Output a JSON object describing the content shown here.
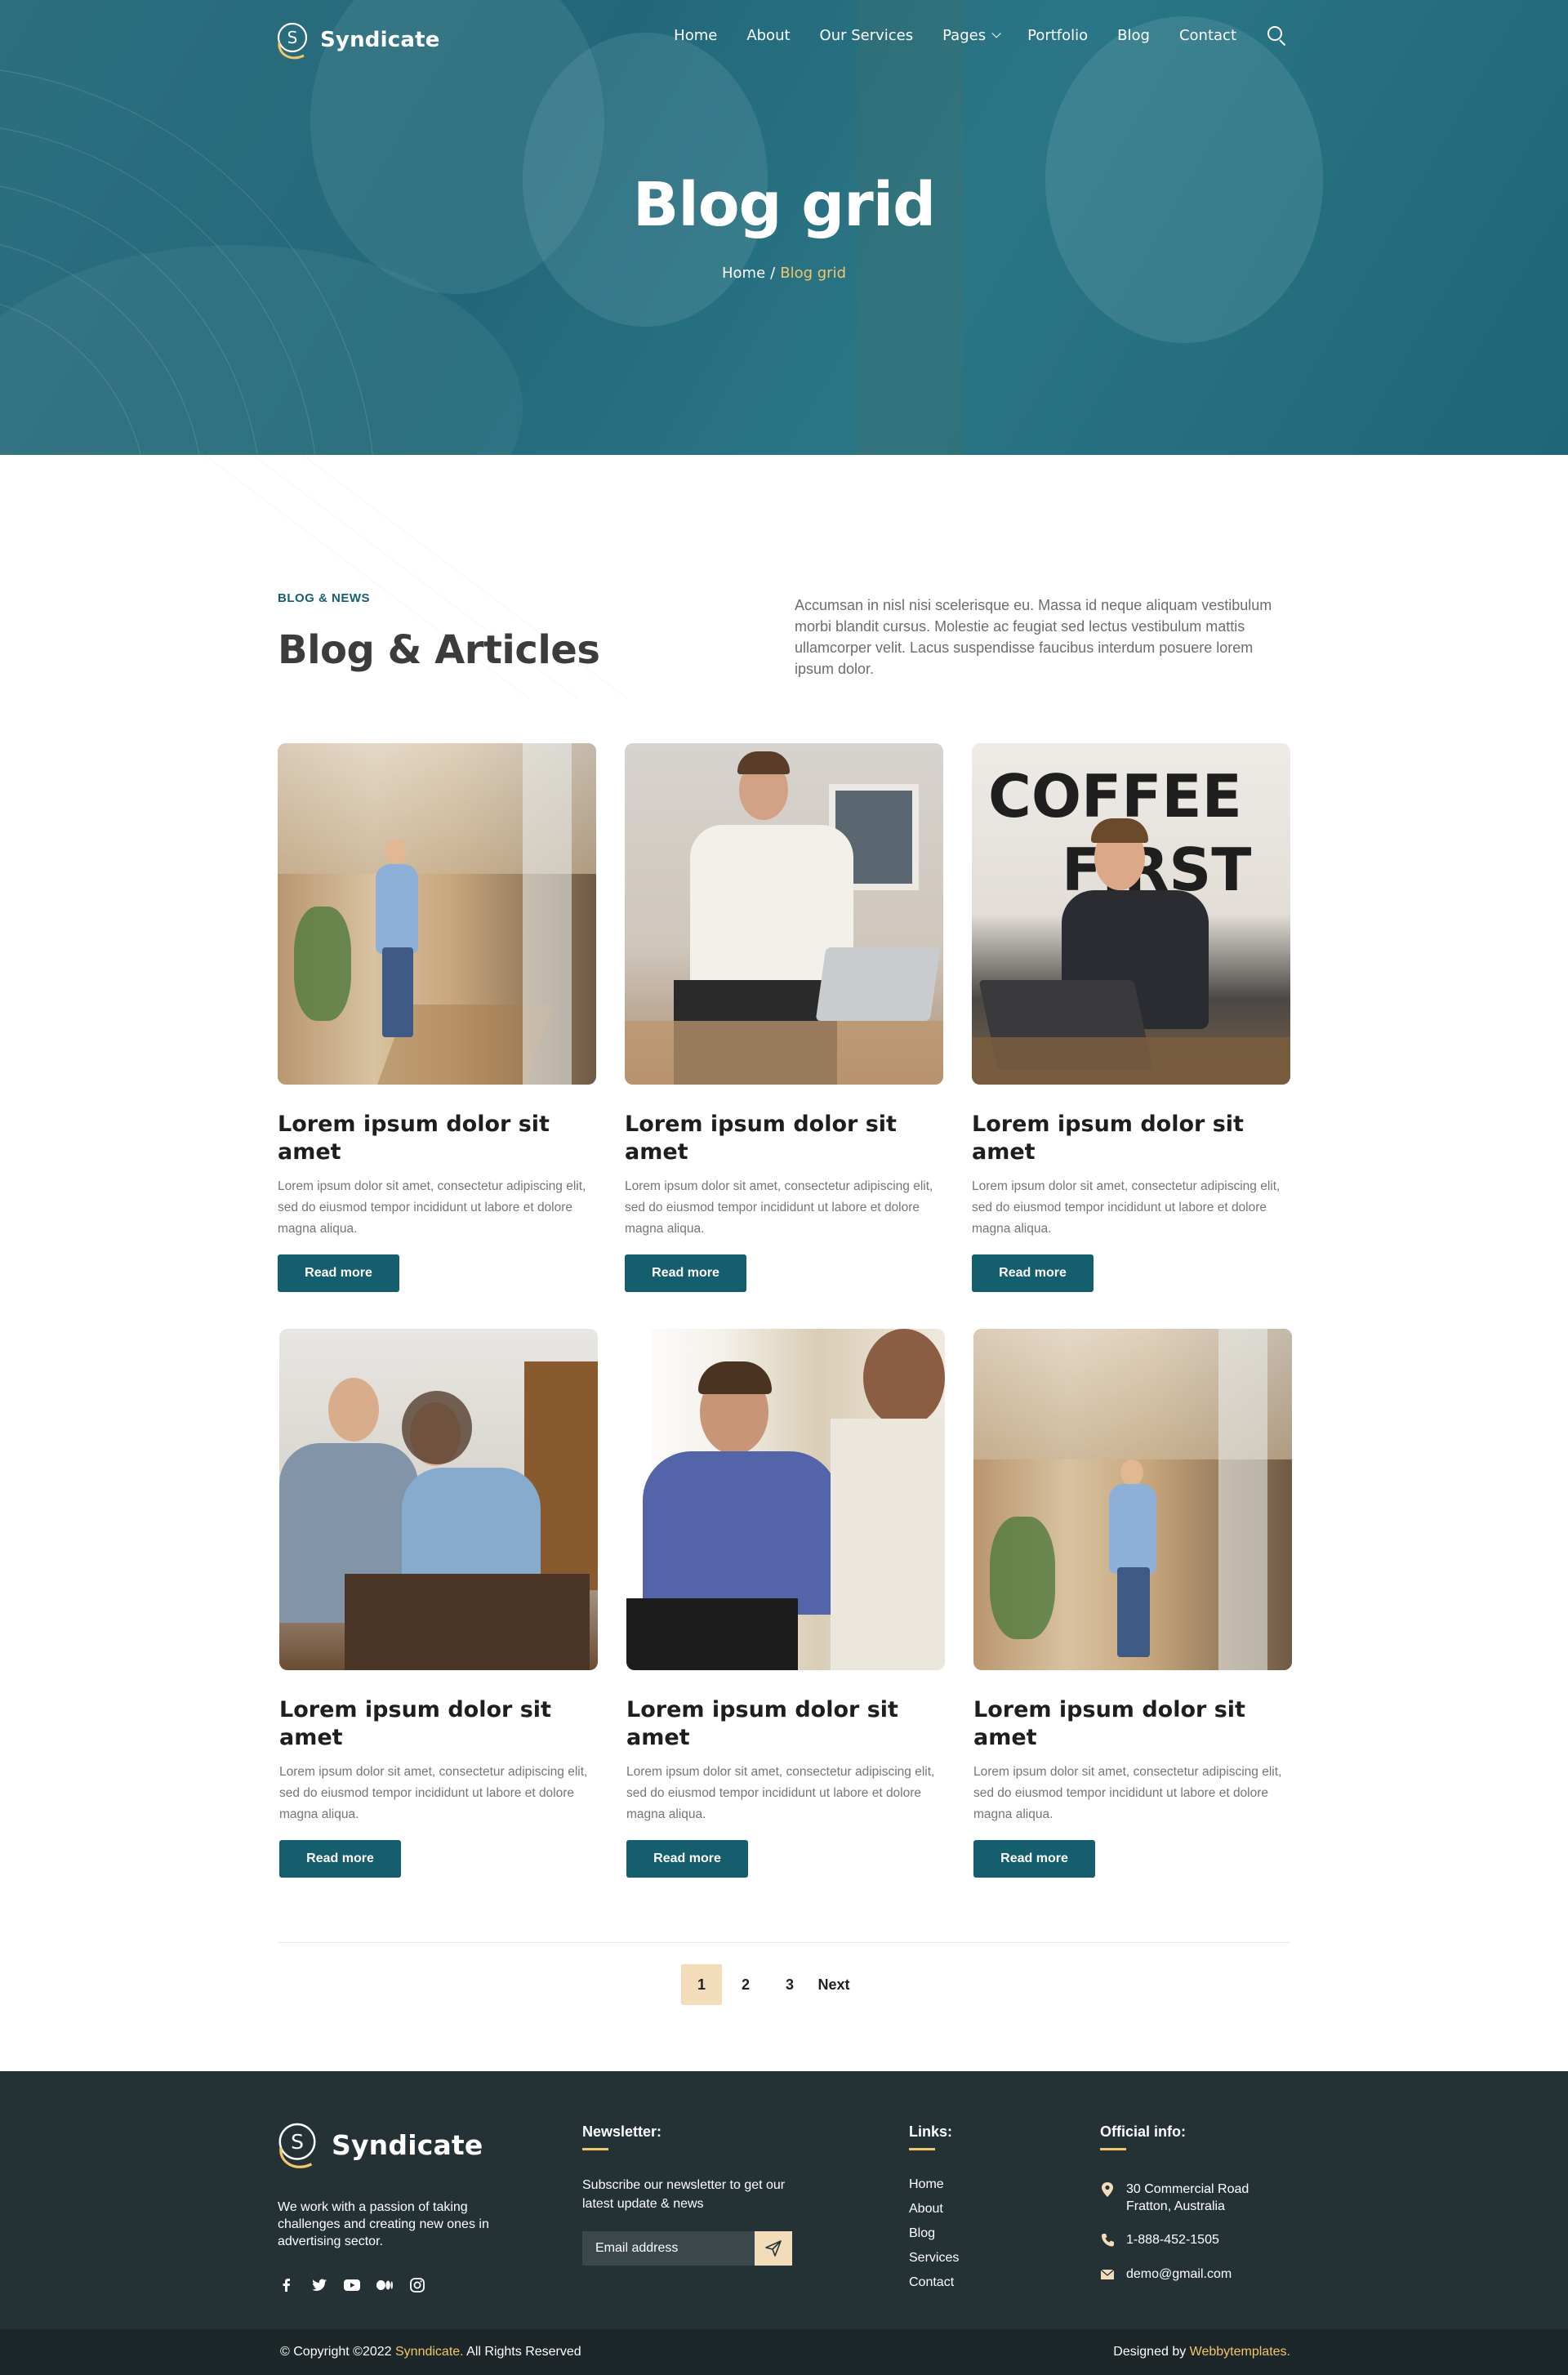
{
  "brand": {
    "name": "Syndicate",
    "logo_letter": "S"
  },
  "nav": {
    "items": [
      "Home",
      "About",
      "Our Services",
      "Pages",
      "Portfolio",
      "Blog",
      "Contact"
    ]
  },
  "hero": {
    "title": "Blog grid",
    "breadcrumb": {
      "home": "Home",
      "separator": "/",
      "current": "Blog grid"
    }
  },
  "intro": {
    "eyebrow": "BLOG & NEWS",
    "title": "Blog & Articles",
    "text": "Accumsan in nisl nisi scelerisque eu. Massa id neque aliquam vestibulum morbi blandit cursus. Molestie ac feugiat sed lectus vestibulum mattis ullamcorper velit. Lacus suspendisse faucibus interdum posuere lorem ipsum dolor."
  },
  "posts": [
    {
      "title": "Lorem ipsum dolor sit amet",
      "excerpt": "Lorem ipsum dolor sit amet, consectetur adipiscing elit, sed do eiusmod tempor incididunt ut labore et dolore magna aliqua.",
      "button": "Read more"
    },
    {
      "title": "Lorem ipsum dolor sit amet",
      "excerpt": "Lorem ipsum dolor sit amet, consectetur adipiscing elit, sed do eiusmod tempor incididunt ut labore et dolore magna aliqua.",
      "button": "Read more"
    },
    {
      "title": "Lorem ipsum dolor sit amet",
      "excerpt": "Lorem ipsum dolor sit amet, consectetur adipiscing elit, sed do eiusmod tempor incididunt ut labore et dolore magna aliqua.",
      "button": "Read more"
    },
    {
      "title": "Lorem ipsum dolor sit amet",
      "excerpt": "Lorem ipsum dolor sit amet, consectetur adipiscing elit, sed do eiusmod tempor incididunt ut labore et dolore magna aliqua.",
      "button": "Read more"
    },
    {
      "title": "Lorem ipsum dolor sit amet",
      "excerpt": "Lorem ipsum dolor sit amet, consectetur adipiscing elit, sed do eiusmod tempor incididunt ut labore et dolore magna aliqua.",
      "button": "Read more"
    },
    {
      "title": "Lorem ipsum dolor sit amet",
      "excerpt": "Lorem ipsum dolor sit amet, consectetur adipiscing elit, sed do eiusmod tempor incididunt ut labore et dolore magna aliqua.",
      "button": "Read more"
    }
  ],
  "pagination": {
    "pages": [
      "1",
      "2",
      "3"
    ],
    "active": "1",
    "next": "Next"
  },
  "footer": {
    "about": "We work with a passion of taking challenges and creating new ones in advertising sector.",
    "socials": [
      "facebook-icon",
      "twitter-icon",
      "youtube-icon",
      "medium-icon",
      "instagram-icon"
    ],
    "newsletter": {
      "title": "Newsletter:",
      "text": "Subscribe our newsletter to get our latest update & news",
      "placeholder": "Email address"
    },
    "links": {
      "title": "Links:",
      "items": [
        "Home",
        "About",
        "Blog",
        "Services",
        "Contact"
      ]
    },
    "info": {
      "title": "Official info:",
      "address_line1": "30 Commercial Road",
      "address_line2": "Fratton, Australia",
      "phone": "1-888-452-1505",
      "email": "demo@gmail.com"
    },
    "copyright_prefix": "© Copyright ©2022",
    "copyright_brand": "Synndicate.",
    "copyright_suffix": "All Rights Reserved",
    "designed_prefix": "Designed by",
    "designed_brand": "Webbytemplates."
  },
  "colors": {
    "primary": "#155e6d",
    "accent": "#f2c66b",
    "active_page": "#f3dcb9",
    "footer_bg": "#243236"
  }
}
